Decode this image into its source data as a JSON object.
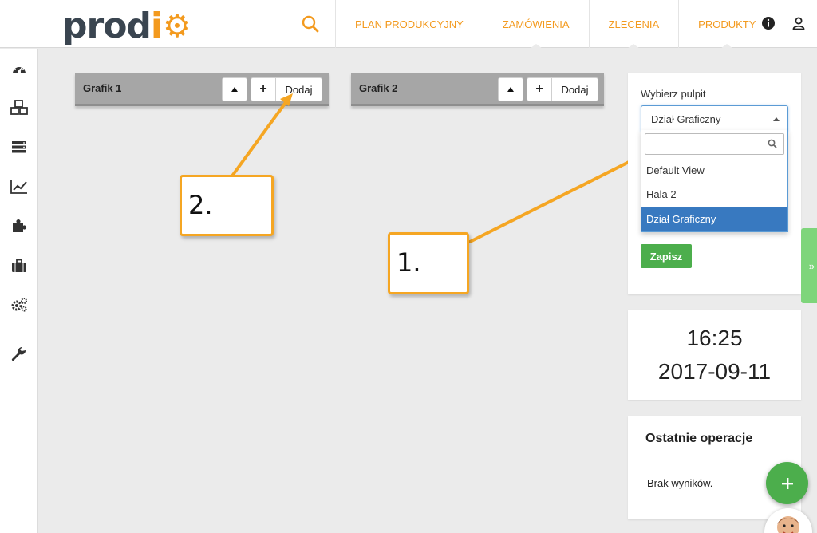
{
  "header": {
    "logo": {
      "part1": "prod",
      "part2": "i",
      "part3": "⚙"
    },
    "nav": [
      {
        "label": "PLAN PRODUKCYJNY"
      },
      {
        "label": "ZAMÓWIENIA"
      },
      {
        "label": "ZLECENIA"
      },
      {
        "label": "PRODUKTY"
      }
    ],
    "icons": [
      "search-icon",
      "info-icon",
      "user-icon"
    ]
  },
  "sidebar": {
    "items": [
      "dashboard-icon",
      "boxes-icon",
      "server-icon",
      "chart-line-icon",
      "puzzle-icon",
      "briefcase-icon",
      "cogs-icon",
      "wrench-icon"
    ]
  },
  "grafiks": [
    {
      "title": "Grafik 1",
      "up_label": "▲",
      "plus_label": "+",
      "add_label": "Dodaj"
    },
    {
      "title": "Grafik 2",
      "up_label": "▲",
      "plus_label": "+",
      "add_label": "Dodaj"
    }
  ],
  "callouts": [
    {
      "label": "2."
    },
    {
      "label": "1."
    }
  ],
  "pulpit": {
    "label": "Wybierz pulpit",
    "selected": "Dział Graficzny",
    "search_value": "",
    "options": [
      "Default View",
      "Hala 2",
      "Dział Graficzny"
    ],
    "save_label": "Zapisz"
  },
  "clock": {
    "time": "16:25",
    "date": "2017-09-11"
  },
  "operations": {
    "title": "Ostatnie operacje",
    "empty": "Brak wyników."
  },
  "side_tab": {
    "label": "»"
  },
  "fab": {
    "label": "+"
  },
  "colors": {
    "accent": "#f39a1e",
    "logo_dark": "#3a4550",
    "green": "#4cae4c",
    "selected_blue": "#3879c0",
    "callout_border": "#f5a623"
  }
}
